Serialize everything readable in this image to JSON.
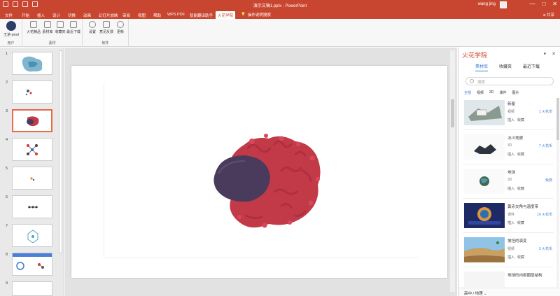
{
  "window": {
    "title": "演示文稿1.pptx - PowerPoint",
    "user": "wang jing",
    "controls": [
      "—",
      "□",
      "✕"
    ]
  },
  "tabs": [
    {
      "label": "文件"
    },
    {
      "label": "开始"
    },
    {
      "label": "插入"
    },
    {
      "label": "设计"
    },
    {
      "label": "切换"
    },
    {
      "label": "动画"
    },
    {
      "label": "幻灯片放映"
    },
    {
      "label": "审阅"
    },
    {
      "label": "视图"
    },
    {
      "label": "帮助"
    },
    {
      "label": "WPS PDF"
    },
    {
      "label": "智能翻译助手"
    },
    {
      "label": "火花学院"
    }
  ],
  "tell_me": "操作说明搜索",
  "share": "共享",
  "ribbon": {
    "groups": [
      {
        "label": "用户",
        "buttons": [
          "王进-prod"
        ]
      },
      {
        "label": "素材",
        "buttons": [
          "火花精品",
          "素材库",
          "收藏夹",
          "最近下载"
        ]
      },
      {
        "label": "软件",
        "buttons": [
          "设置",
          "意见反馈",
          "更新"
        ]
      }
    ]
  },
  "slides": [
    "1",
    "2",
    "3",
    "4",
    "5",
    "6",
    "7",
    "8",
    "9"
  ],
  "right_panel": {
    "title": "火花学院",
    "tabs": [
      "素材库",
      "收藏夹",
      "最近下载"
    ],
    "search_placeholder": "搜索",
    "filters": [
      "全部",
      "视频",
      "3D",
      "课件",
      "图片"
    ],
    "items": [
      {
        "name": "新屋",
        "category": "视频",
        "price": "1 火花币",
        "actions": [
          "插入",
          "收藏"
        ]
      },
      {
        "name": "冰川地貌",
        "category": "3D",
        "price": "7 火花币",
        "actions": [
          "插入",
          "收藏"
        ]
      },
      {
        "name": "地球",
        "category": "3D",
        "price": "免费",
        "actions": [
          "插入",
          "收藏"
        ]
      },
      {
        "name": "黄赤交角与温度带",
        "category": "课件",
        "price": "10 火花币",
        "actions": [
          "插入",
          "收藏"
        ]
      },
      {
        "name": "坡坦的演变",
        "category": "视频",
        "price": "3 火花币",
        "actions": [
          "插入",
          "收藏"
        ]
      },
      {
        "name": "地球的内部圈层结构",
        "category": "",
        "price": "",
        "actions": []
      }
    ],
    "footer": "高中 / 地理"
  },
  "colors": {
    "accent": "#c8462f",
    "link": "#3a7bd5",
    "organelle": "#c23a48",
    "nucleus": "#4a3b5c"
  }
}
